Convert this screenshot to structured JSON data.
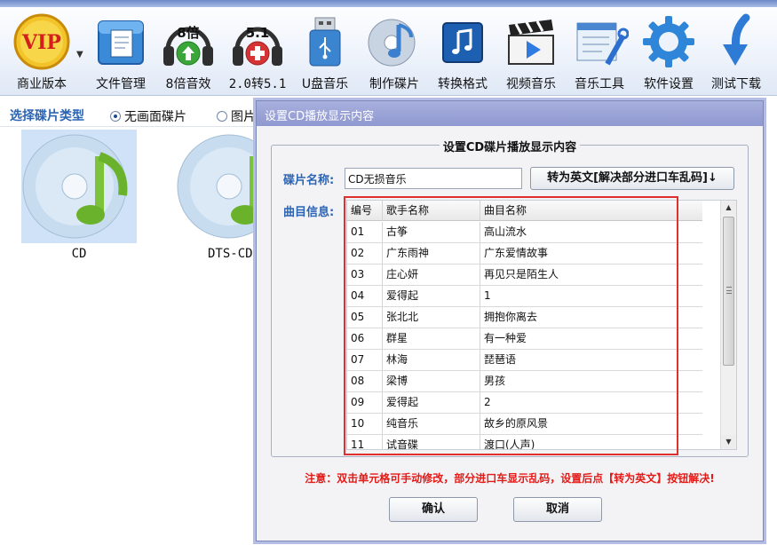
{
  "toolbar": {
    "items": [
      {
        "label": "商业版本",
        "icon": "vip-badge-icon",
        "badge": "VIP"
      },
      {
        "label": "文件管理",
        "icon": "file-manager-icon"
      },
      {
        "label": "8倍音效",
        "icon": "headphones-8x-icon",
        "badge": "8倍"
      },
      {
        "label": "2.0转5.1",
        "icon": "headphones-51-icon",
        "badge": "5.1"
      },
      {
        "label": "U盘音乐",
        "icon": "usb-drive-icon"
      },
      {
        "label": "制作碟片",
        "icon": "disc-note-icon"
      },
      {
        "label": "转换格式",
        "icon": "music-convert-icon"
      },
      {
        "label": "视频音乐",
        "icon": "video-clapper-icon"
      },
      {
        "label": "音乐工具",
        "icon": "music-tools-icon"
      },
      {
        "label": "软件设置",
        "icon": "settings-gear-icon"
      },
      {
        "label": "测试下载",
        "icon": "download-arrow-icon"
      }
    ]
  },
  "left": {
    "disc_type_title": "选择碟片类型",
    "radio_no_screen": "无画面碟片",
    "radio_picture": "图片",
    "discs": [
      {
        "label": "CD"
      },
      {
        "label": "DTS-CD"
      }
    ]
  },
  "dialog": {
    "title": "设置CD播放显示内容",
    "group_title": "设置CD碟片播放显示内容",
    "disc_name_label": "碟片名称:",
    "disc_name_value": "CD无损音乐",
    "convert_button": "转为英文[解决部分进口车乱码]↓",
    "track_info_label": "曲目信息:",
    "grid": {
      "headers": [
        "编号",
        "歌手名称",
        "曲目名称"
      ],
      "rows": [
        [
          "01",
          "古筝",
          "高山流水"
        ],
        [
          "02",
          "广东雨神",
          "广东爱情故事"
        ],
        [
          "03",
          "庄心妍",
          "再见只是陌生人"
        ],
        [
          "04",
          "爱得起",
          "1"
        ],
        [
          "05",
          "张北北",
          "拥抱你离去"
        ],
        [
          "06",
          "群星",
          "有一种爱"
        ],
        [
          "07",
          "林海",
          "琵琶语"
        ],
        [
          "08",
          "梁博",
          "男孩"
        ],
        [
          "09",
          "爱得起",
          "2"
        ],
        [
          "10",
          "纯音乐",
          "故乡的原风景"
        ],
        [
          "11",
          "试音碟",
          "渡口(人声)"
        ]
      ]
    },
    "notice": "注意：双击单元格可手动修改，部分进口车显示乱码，设置后点【转为英文】按钮解决!",
    "ok_button": "确认",
    "cancel_button": "取消"
  },
  "colors": {
    "accent_blue": "#2b64b4",
    "dialog_titlebar": "#9aa2d6",
    "highlight_red": "#e0302e",
    "notice_red": "#e31b17"
  }
}
